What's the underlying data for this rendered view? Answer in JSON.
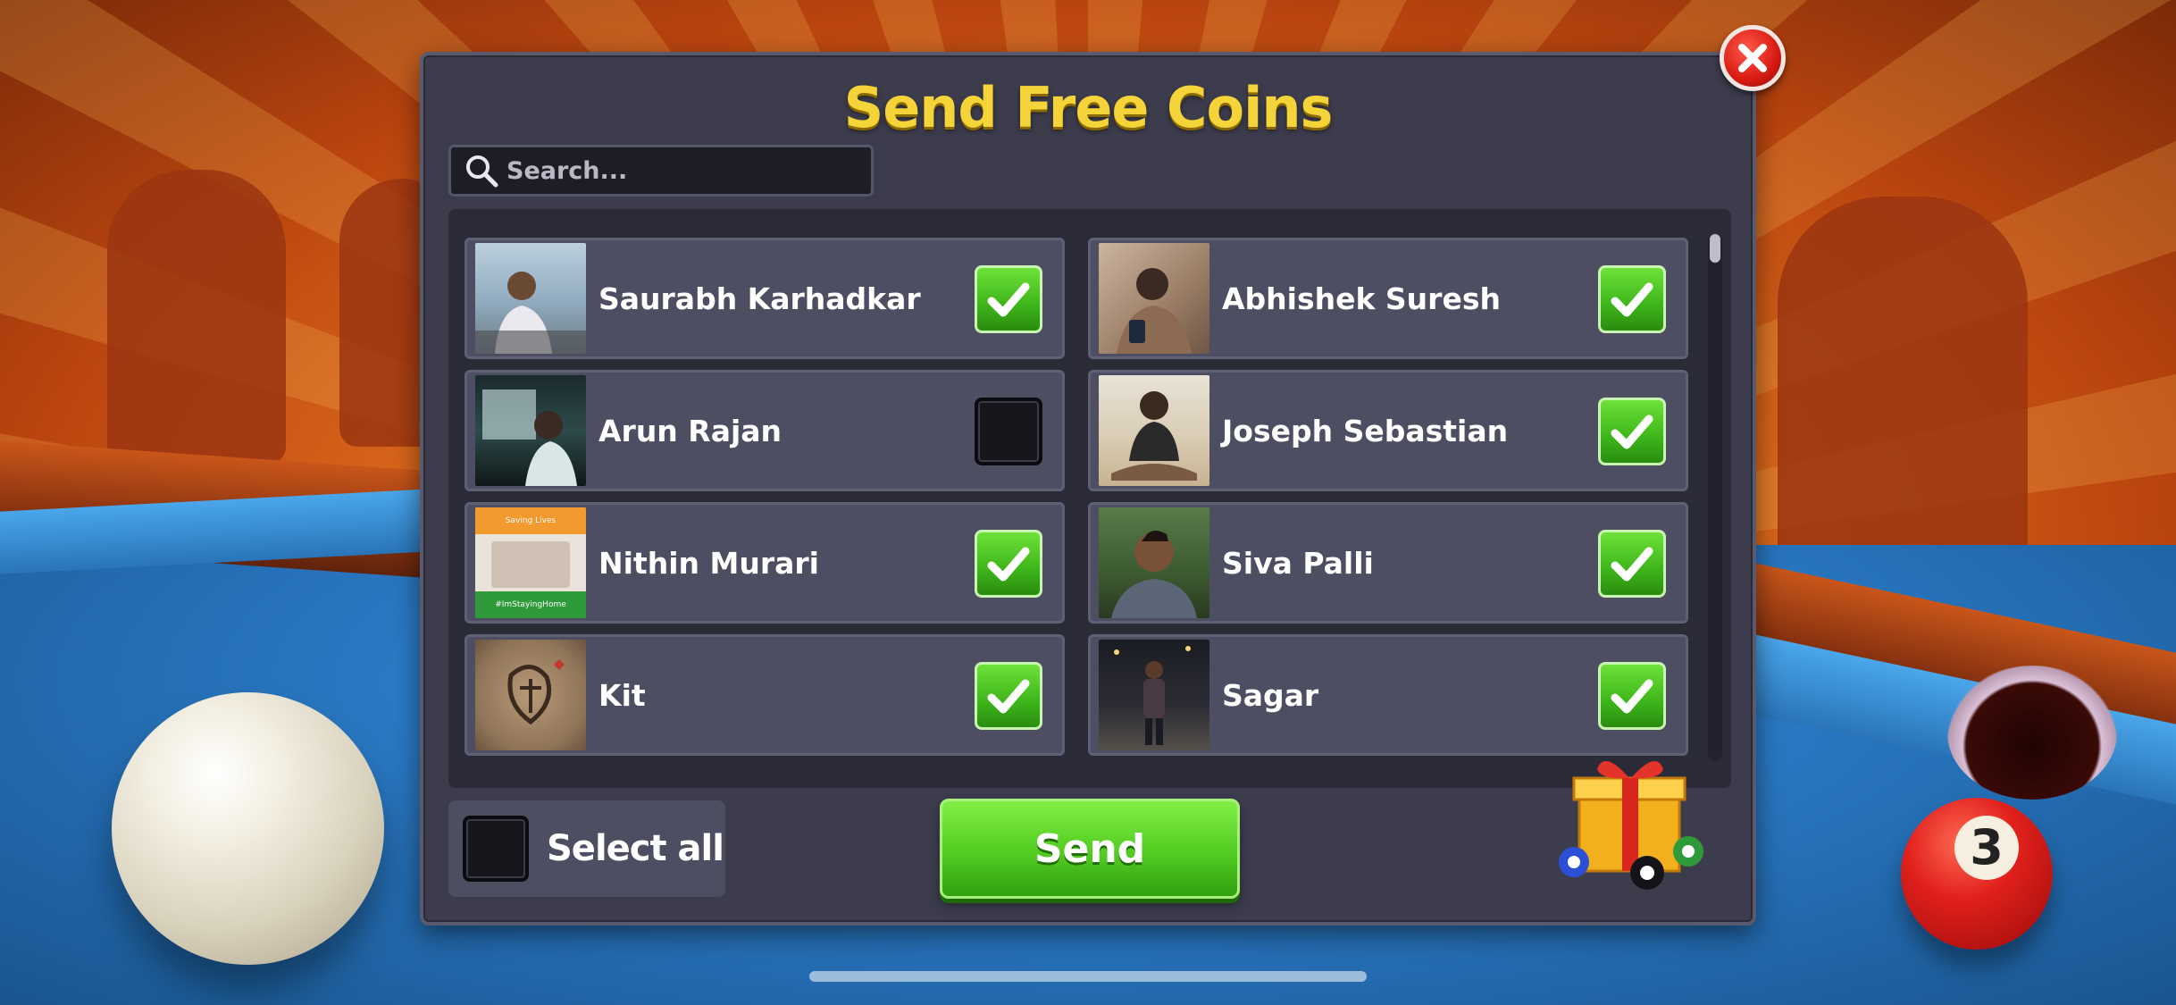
{
  "dialog": {
    "title": "Send Free Coins",
    "search": {
      "placeholder": "Search..."
    },
    "friends": [
      {
        "name": "Saurabh Karhadkar",
        "checked": true,
        "avatar": "person-at-sea"
      },
      {
        "name": "Abhishek Suresh",
        "checked": true,
        "avatar": "person-with-phone"
      },
      {
        "name": "Arun Rajan",
        "checked": false,
        "avatar": "person-at-window"
      },
      {
        "name": "Joseph Sebastian",
        "checked": true,
        "avatar": "person-seated"
      },
      {
        "name": "Nithin Murari",
        "checked": true,
        "avatar": "saving-lives-frame",
        "avatar_caption_top": "Saving Lives",
        "avatar_caption_bottom": "#ImStayingHome"
      },
      {
        "name": "Siva Palli",
        "checked": true,
        "avatar": "portrait"
      },
      {
        "name": "Kit",
        "checked": true,
        "avatar": "tattoo-art"
      },
      {
        "name": "Sagar",
        "checked": true,
        "avatar": "person-night-street"
      }
    ],
    "select_all_label": "Select all",
    "send_label": "Send"
  },
  "scene": {
    "ball_number": "3"
  },
  "colors": {
    "title": "#f5d43a",
    "send_green": "#52cc22",
    "close_red": "#d81a12",
    "panel": "#3c3c4d"
  }
}
